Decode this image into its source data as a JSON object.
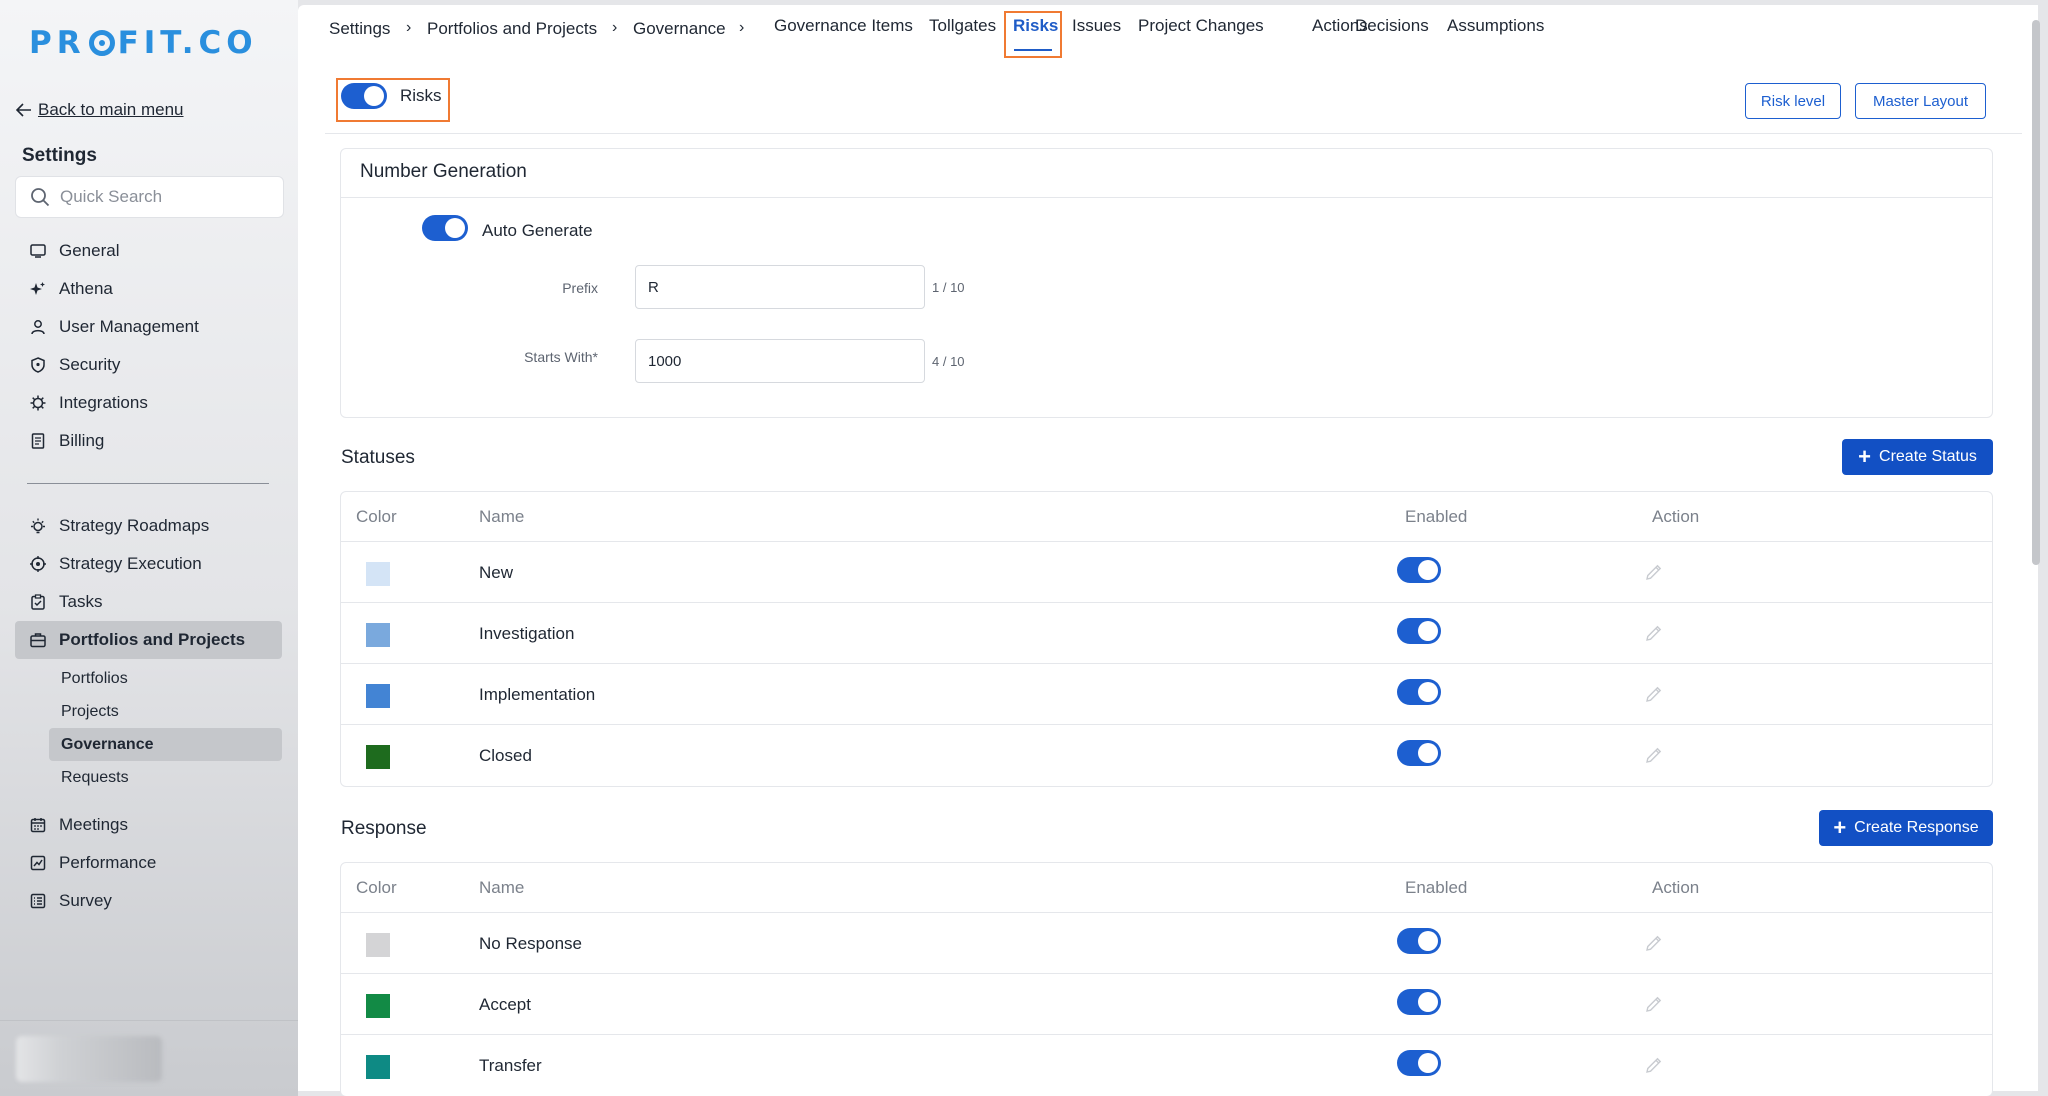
{
  "brand": {
    "logo_prefix": "PR",
    "logo_suffix": "FIT.CO"
  },
  "sidebar": {
    "back_label": "Back to main menu",
    "title": "Settings",
    "search_placeholder": "Quick Search",
    "group1": [
      {
        "label": "General",
        "icon": "monitor-icon"
      },
      {
        "label": "Athena",
        "icon": "sparkle-icon"
      },
      {
        "label": "User Management",
        "icon": "user-icon"
      },
      {
        "label": "Security",
        "icon": "shield-icon"
      },
      {
        "label": "Integrations",
        "icon": "gear-icon"
      },
      {
        "label": "Billing",
        "icon": "receipt-icon"
      }
    ],
    "group2": [
      {
        "label": "Strategy Roadmaps",
        "icon": "lightbulb-icon"
      },
      {
        "label": "Strategy Execution",
        "icon": "target-icon"
      },
      {
        "label": "Tasks",
        "icon": "clipboard-check-icon"
      },
      {
        "label": "Portfolios and Projects",
        "icon": "briefcase-icon"
      }
    ],
    "sub_items": [
      "Portfolios",
      "Projects",
      "Governance",
      "Requests"
    ],
    "group3": [
      {
        "label": "Meetings",
        "icon": "calendar-icon"
      },
      {
        "label": "Performance",
        "icon": "chart-icon"
      },
      {
        "label": "Survey",
        "icon": "survey-icon"
      }
    ]
  },
  "breadcrumb": [
    "Settings",
    "Portfolios and Projects",
    "Governance"
  ],
  "tabs": [
    "Governance Items",
    "Tollgates",
    "Risks",
    "Issues",
    "Project Changes",
    "Actions",
    "Decisions",
    "Assumptions"
  ],
  "risk_header": {
    "toggle_label": "Risks",
    "risk_level_btn": "Risk level",
    "master_layout_btn": "Master Layout"
  },
  "number_generation": {
    "title": "Number Generation",
    "auto_label": "Auto Generate",
    "prefix_label": "Prefix",
    "prefix_value": "R",
    "prefix_count": "1 / 10",
    "starts_label": "Starts With*",
    "starts_value": "1000",
    "starts_count": "4 / 10"
  },
  "statuses": {
    "title": "Statuses",
    "create_label": "Create Status",
    "headers": {
      "color": "Color",
      "name": "Name",
      "enabled": "Enabled",
      "action": "Action"
    },
    "rows": [
      {
        "name": "New",
        "color": "#d4e4f6"
      },
      {
        "name": "Investigation",
        "color": "#7aa9dd"
      },
      {
        "name": "Implementation",
        "color": "#4384d4"
      },
      {
        "name": "Closed",
        "color": "#1e6b1e"
      }
    ]
  },
  "response": {
    "title": "Response",
    "create_label": "Create Response",
    "headers": {
      "color": "Color",
      "name": "Name",
      "enabled": "Enabled",
      "action": "Action"
    },
    "rows": [
      {
        "name": "No Response",
        "color": "#d4d4d6"
      },
      {
        "name": "Accept",
        "color": "#128a45"
      },
      {
        "name": "Transfer",
        "color": "#0e8a84"
      }
    ]
  },
  "colors": {
    "accent": "#1d5fd0",
    "highlight": "#f07a32",
    "logo": "#2a8fde"
  }
}
